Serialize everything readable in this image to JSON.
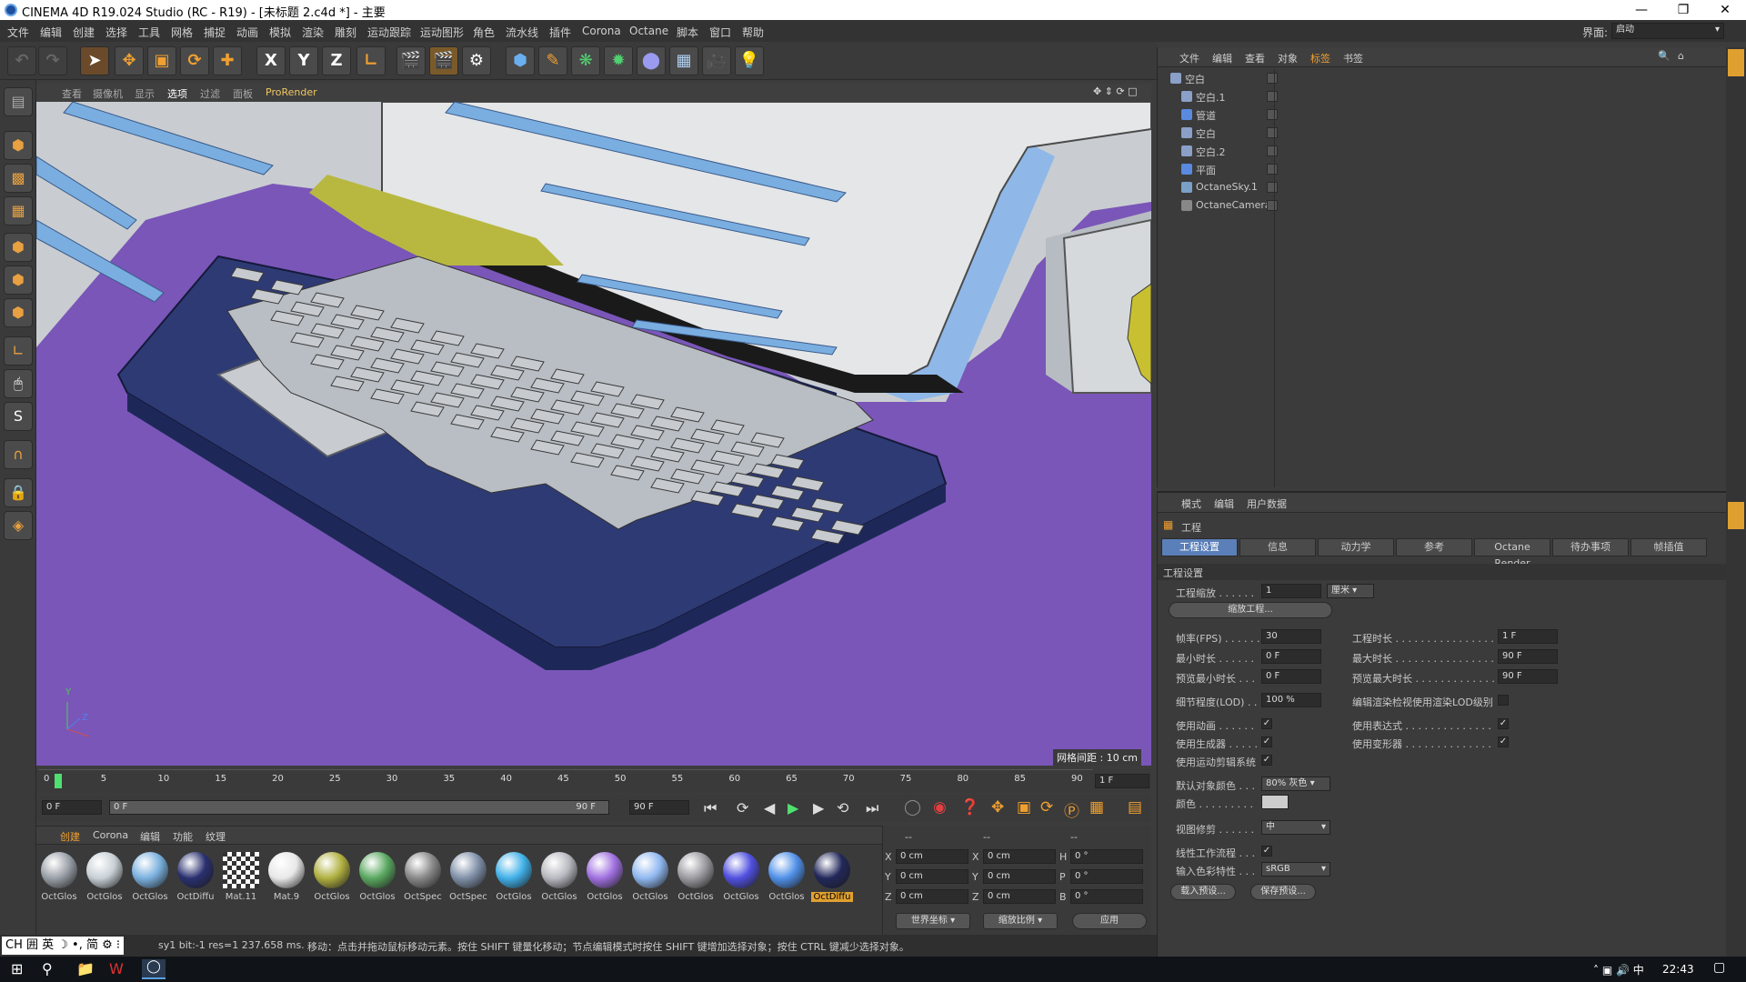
{
  "window": {
    "title": "CINEMA 4D R19.024 Studio (RC - R19) - [未标题 2.c4d *] - 主要",
    "layout_label": "界面:",
    "layout_value": "启动"
  },
  "menu": [
    "文件",
    "编辑",
    "创建",
    "选择",
    "工具",
    "网格",
    "捕捉",
    "动画",
    "模拟",
    "渲染",
    "雕刻",
    "运动跟踪",
    "运动图形",
    "角色",
    "流水线",
    "插件",
    "Corona",
    "Octane",
    "脚本",
    "窗口",
    "帮助"
  ],
  "toolbar": {
    "x_btn": "X",
    "y_btn": "Y",
    "z_btn": "Z"
  },
  "viewport": {
    "menu": [
      "查看",
      "摄像机",
      "显示",
      "选项",
      "过滤",
      "面板",
      "ProRender"
    ],
    "grid_label": "网格间距 : 10 cm"
  },
  "timeline": {
    "ticks": [
      "0",
      "5",
      "10",
      "15",
      "20",
      "25",
      "30",
      "35",
      "40",
      "45",
      "50",
      "55",
      "60",
      "65",
      "70",
      "75",
      "80",
      "85",
      "90"
    ],
    "current_frame": "1 F",
    "playhead_fraction": 0.011
  },
  "playbar": {
    "start": "0 F",
    "range_start": "0 F",
    "range_end": "90 F",
    "end": "90 F"
  },
  "materials": {
    "tabs": [
      "创建",
      "Corona",
      "编辑",
      "功能",
      "纹理"
    ],
    "items": [
      {
        "name": "OctGlos",
        "color": "#9aa0a8"
      },
      {
        "name": "OctGlos",
        "color": "#c8d0d6"
      },
      {
        "name": "OctGlos",
        "color": "#7ab0de"
      },
      {
        "name": "OctDiffu",
        "color": "#2a3070"
      },
      {
        "name": "Mat.11",
        "color": "checker"
      },
      {
        "name": "Mat.9",
        "color": "#e8e8e8"
      },
      {
        "name": "OctGlos",
        "color": "#b0b040"
      },
      {
        "name": "OctGlos",
        "color": "#5aa860"
      },
      {
        "name": "OctSpec",
        "color": "#888888"
      },
      {
        "name": "OctSpec",
        "color": "#8090a8"
      },
      {
        "name": "OctGlos",
        "color": "#40b0e8"
      },
      {
        "name": "OctGlos",
        "color": "#b8b8c0"
      },
      {
        "name": "OctGlos",
        "color": "#a070e0"
      },
      {
        "name": "OctGlos",
        "color": "#90b8f0"
      },
      {
        "name": "OctGlos",
        "color": "#9a9aa0"
      },
      {
        "name": "OctGlos",
        "color": "#5050e0"
      },
      {
        "name": "OctGlos",
        "color": "#5090e8"
      },
      {
        "name": "OctDiffu",
        "color": "#22285a"
      }
    ]
  },
  "coords": {
    "header": [
      "--",
      "--",
      "--"
    ],
    "rows": [
      {
        "a": "X",
        "av": "0 cm",
        "b": "X",
        "bv": "0 cm",
        "c": "H",
        "cv": "0 °"
      },
      {
        "a": "Y",
        "av": "0 cm",
        "b": "Y",
        "bv": "0 cm",
        "c": "P",
        "cv": "0 °"
      },
      {
        "a": "Z",
        "av": "0 cm",
        "b": "Z",
        "bv": "0 cm",
        "c": "B",
        "cv": "0 °"
      }
    ],
    "world": "世界坐标",
    "scale": "缩放比例",
    "apply": "应用"
  },
  "status": {
    "left": "sy1  bit:-1 res=1  237.658 ms.",
    "hint": "移动：点击并拖动鼠标移动元素。按住 SHIFT 键量化移动；节点编辑模式时按住 SHIFT 键增加选择对象；按住 CTRL 键减少选择对象。",
    "ime": "CH 囲 英 ☽ •, 简 ⚙ ⁝"
  },
  "objects": {
    "menu": [
      "文件",
      "编辑",
      "查看",
      "对象",
      "标签",
      "书签"
    ],
    "items": [
      {
        "name": "空白",
        "indent": 0,
        "icon": "#8aa0c8"
      },
      {
        "name": "空白.1",
        "indent": 1,
        "icon": "#8aa0c8"
      },
      {
        "name": "管道",
        "indent": 1,
        "icon": "#5a8ae0"
      },
      {
        "name": "空白",
        "indent": 1,
        "icon": "#8aa0c8"
      },
      {
        "name": "空白.2",
        "indent": 1,
        "icon": "#8aa0c8"
      },
      {
        "name": "平面",
        "indent": 1,
        "icon": "#5a8ae0"
      },
      {
        "name": "OctaneSky.1",
        "indent": 1,
        "icon": "#7aa0c8"
      },
      {
        "name": "OctaneCamera",
        "indent": 1,
        "icon": "#888888"
      }
    ]
  },
  "attributes": {
    "menu": [
      "模式",
      "编辑",
      "用户数据"
    ],
    "object": "工程",
    "tabs": [
      "工程设置",
      "信息",
      "动力学",
      "参考",
      "Octane Render",
      "待办事项",
      "帧插值"
    ],
    "section": "工程设置",
    "scale_label": "工程缩放 . . . . . .",
    "scale_value": "1",
    "scale_unit": "厘米",
    "scale_btn": "缩放工程...",
    "fps_label": "帧率(FPS) . . . . . .",
    "fps_value": "30",
    "projtime_label": "工程时长 . . . . . . . . . . . . . . . . .",
    "projtime_value": "1 F",
    "min_label": "最小时长 . . . . . .",
    "min_value": "0 F",
    "max_label": "最大时长 . . . . . . . . . . . . . . . . .",
    "max_value": "90 F",
    "pmin_label": "预览最小时长 . . .",
    "pmin_value": "0 F",
    "pmax_label": "预览最大时长 . . . . . . . . . . . . . .",
    "pmax_value": "90 F",
    "lod_label": "细节程度(LOD) . .",
    "lod_value": "100 %",
    "lod_edit_label": "编辑渲染检视使用渲染LOD级别",
    "anim_label": "使用动画 . . . . . .",
    "expr_label": "使用表达式 . . . . . . . . . . . . . .",
    "gen_label": "使用生成器 . . . . .",
    "deform_label": "使用变形器 . . . . . . . . . . . . . .",
    "mograph_label": "使用运动剪辑系统",
    "defcolor_label": "默认对象颜色 . . .",
    "defcolor_value": "80% 灰色",
    "color_label": "颜色 . . . . . . . . .",
    "view_label": "视图修剪 . . . . . .",
    "view_value": "中",
    "linear_label": "线性工作流程 . . .",
    "input_label": "输入色彩特性 . . .",
    "input_value": "sRGB",
    "load_btn": "载入预设...",
    "save_btn": "保存预设..."
  },
  "taskbar": {
    "time": "22:43"
  }
}
